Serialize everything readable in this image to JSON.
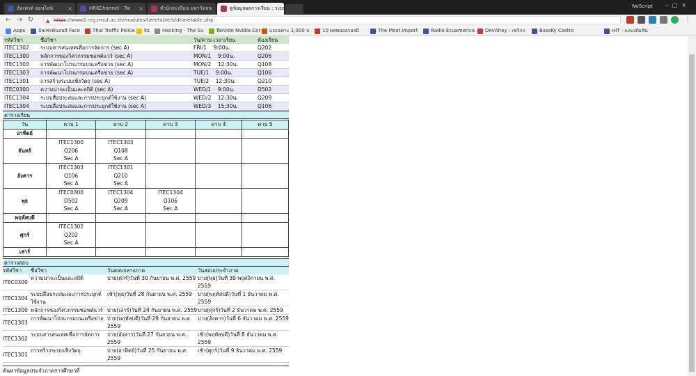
{
  "browser": {
    "tabs": [
      {
        "label": "อัลเฟรด์ ออนไลน์",
        "color": "#3b5998"
      },
      {
        "label": "HRKChannel - Tw",
        "color": "#6441a5"
      },
      {
        "label": "สำนักทะเบียน มหาวิทยา",
        "color": "#b03060"
      },
      {
        "label": "ดูข้อมูลผลการเรียน : ระบบ",
        "color": "#b03060"
      }
    ],
    "noscript": "NoScript",
    "address": {
      "scheme": "https",
      "rest": "://www2.reg.rmut.ac.th/modules/timetable/stdtimetable.php"
    },
    "bookmarks": [
      {
        "label": "Apps",
        "color": "#4285f4"
      },
      {
        "label": "อัลเฟรดิบอนสิ Face",
        "color": "#3b5998"
      },
      {
        "label": "Thai Traffic Police",
        "color": "#c0392b"
      },
      {
        "label": "ks",
        "color": "#f1c40f"
      },
      {
        "label": "Hacking - The Su",
        "color": "#888"
      },
      {
        "label": "ฟีดVide Nvidia Cor",
        "color": "#76b900"
      },
      {
        "label": "แมเฉพาะ 1,000 บ",
        "color": "#d35400"
      },
      {
        "label": "10 ผลพยอลรองมี",
        "color": "#c0392b"
      },
      {
        "label": "The Most Import",
        "color": "#3b5998"
      },
      {
        "label": "Radio Ecuamerica",
        "color": "#3b5998"
      },
      {
        "label": "DevAhoy : เขริกก",
        "color": "#c0392b"
      },
      {
        "label": "BassKy Castro",
        "color": "#3b5998"
      },
      {
        "label": "HIT - และเติมสิน",
        "color": "#3b5998"
      }
    ]
  },
  "registered": {
    "headers": [
      "รหัสวิชา",
      "ชื่อวิชา",
      "วัน/คาบ-เวลาเรียน",
      "ห้องเรียน"
    ],
    "rows": [
      [
        "ITEC1302",
        "ระบบสารสนเทศเพื่อการจัดการ (sec A)",
        "FRI/1    9:00น.",
        "Q202"
      ],
      [
        "ITEC1300",
        "หลักการของวิศวกรรมซอฟต์แวร์ (sec A)",
        "MON/1    9:00น.",
        "Q206"
      ],
      [
        "ITEC1303",
        "การพัฒนาโปรแกรมบนเครือข่าย (sec A)",
        "MON/2    12:30น.",
        "Q108"
      ],
      [
        "ITEC1303",
        "การพัฒนาโปรแกรมบนเครือข่าย (sec A)",
        "TUE/1    9:00น.",
        "Q106"
      ],
      [
        "ITEC1301",
        "การสร้างระบบเชิงวัตถุ (sec A)",
        "TUE/2    12:30น.",
        "Q210"
      ],
      [
        "ITEC0300",
        "ความน่าจะเป็นและสถิติ (sec A)",
        "WED/1    9:00น.",
        "D502"
      ],
      [
        "ITEC1304",
        "ระบบสื่อประสมและการประยุกต์ใช้งาน (sec A)",
        "WED/2    12:30น.",
        "Q209"
      ],
      [
        "ITEC1304",
        "ระบบสื่อประสมและการประยุกต์ใช้งาน (sec A)",
        "WED/3    15:30น.",
        "Q106"
      ]
    ]
  },
  "timetable": {
    "title": "ตารางเรียน",
    "headers": [
      "วัน",
      "คาบ 1",
      "คาบ 2",
      "คาบ 3",
      "คาบ 4",
      "คาบ 5"
    ],
    "days": [
      {
        "day": "อาทิตย์",
        "cells": [
          "",
          "",
          "",
          "",
          ""
        ]
      },
      {
        "day": "จันทร์",
        "cells": [
          "ITEC1300\nQ206\nSec A",
          "ITEC1303\nQ108\nSec A",
          "",
          "",
          ""
        ]
      },
      {
        "day": "อังคาร",
        "cells": [
          "ITEC1303\nQ106\nSec A",
          "ITEC1301\nQ210\nSec A",
          "",
          "",
          ""
        ]
      },
      {
        "day": "พุธ",
        "cells": [
          "ITEC0300\nD502\nSec A",
          "ITEC1304\nQ209\nSec A",
          "ITEC1304\nQ106\nSec A",
          "",
          ""
        ]
      },
      {
        "day": "พฤหัสบดี",
        "cells": [
          "",
          "",
          "",
          "",
          ""
        ]
      },
      {
        "day": "ศุกร์",
        "cells": [
          "ITEC1302\nQ202\nSec A",
          "",
          "",
          "",
          ""
        ]
      },
      {
        "day": "เสาร์",
        "cells": [
          "",
          "",
          "",
          "",
          ""
        ]
      }
    ]
  },
  "exams": {
    "title": "ตารางสอบ",
    "headers": [
      "รหัสวิชา",
      "ชื่อวิชา",
      "วันสอบกลางภาค",
      "วันสอบประจำภาค"
    ],
    "rows": [
      [
        "ITEC0300",
        "ความน่าจะเป็นและสถิติ",
        "บ่าย(ศกร์)วันที่ 30 กันยายน พ.ศ. 2559",
        "บ่าย(พุธ)วันที่ 30 พฤศจิกายน พ.ศ. 2559"
      ],
      [
        "ITEC1304",
        "ระบบสื่อประสมและการประยุกต์ใช้งาน",
        "เช้า(พุธ)วันที่ 28 กันยายน พ.ศ. 2559",
        "บ่าย(พฤหัสบดี)วันที่ 1 ธันวาคม พ.ศ. 2559"
      ],
      [
        "ITEC1300",
        "หลักการของวิศวกรรมซอฟต์แวร์",
        "บ่าย(เสาร์)วันที่ 24 กันยายน พ.ศ. 2559",
        "บ่าย(ศุกร์)วันที่ 2 ธันวาคม พ.ศ. 2559"
      ],
      [
        "ITEC1303",
        "การพัฒนาโปรแกรมบนเครือข่าย",
        "บ่าย(พฤหัสบดี)วันที่ 29 กันยายน พ.ศ. 2559",
        "บ่าย(อังคาร)วันที่ 6 ธันวาคม พ.ศ. 2559"
      ],
      [
        "ITEC1302",
        "ระบบสารสนเทศเพื่อการจัดการ",
        "บ่าย(อังคาร)วันที่ 27 กันยายน พ.ศ. 2559",
        "เช้า(พฤหัสบดี)วันที่ 8 ธันวาคม พ.ศ. 2559"
      ],
      [
        "ITEC1301",
        "การสร้างระบบเชิงวัตถุ",
        "บ่าย(อาทิตย์)วันที่ 25 กันยายน พ.ศ. 2559",
        "เช้า(ศุกร์)วันที่ 9 ธันวาคม พ.ศ. 2559"
      ]
    ]
  },
  "footer": {
    "title": "ค้นหาข้อมูลประจำภาคการศึกษาที่"
  }
}
